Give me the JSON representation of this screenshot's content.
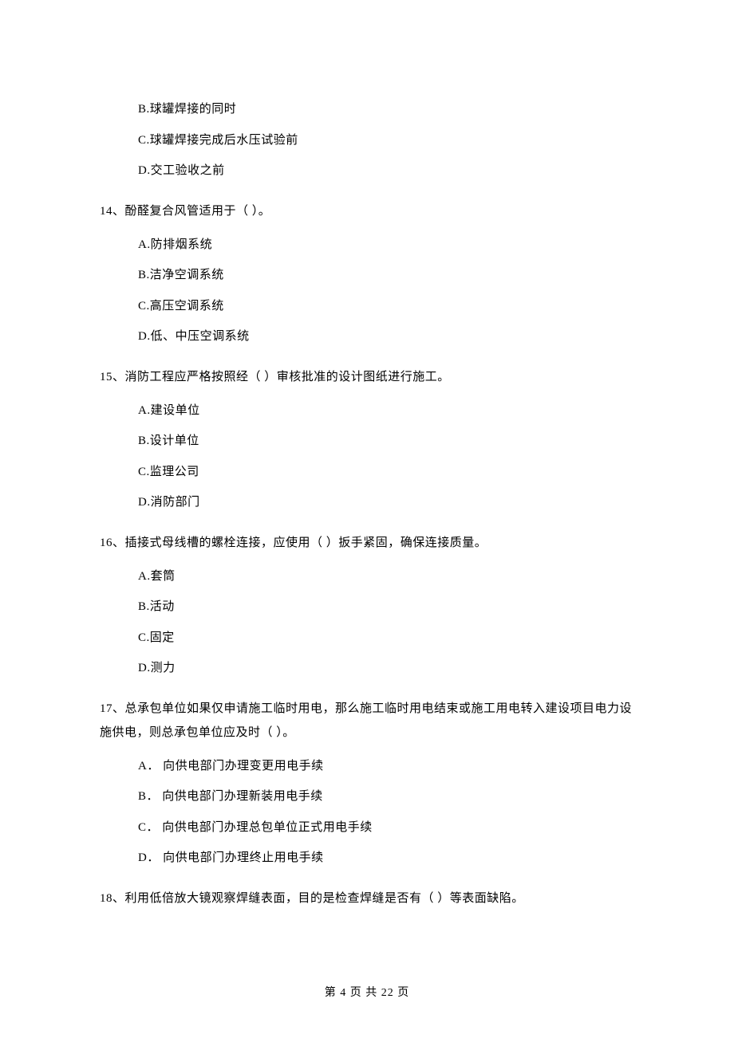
{
  "options_pre": {
    "b": "B.球罐焊接的同时",
    "c": "C.球罐焊接完成后水压试验前",
    "d": "D.交工验收之前"
  },
  "q14": {
    "stem": "14、酚醛复合风管适用于（    ）。",
    "a": "A.防排烟系统",
    "b": "B.洁净空调系统",
    "c": "C.高压空调系统",
    "d": "D.低、中压空调系统"
  },
  "q15": {
    "stem": "15、消防工程应严格按照经（    ）审核批准的设计图纸进行施工。",
    "a": "A.建设单位",
    "b": "B.设计单位",
    "c": "C.监理公司",
    "d": "D.消防部门"
  },
  "q16": {
    "stem": "16、插接式母线槽的螺栓连接，应使用（    ）扳手紧固，确保连接质量。",
    "a": "A.套筒",
    "b": "B.活动",
    "c": "C.固定",
    "d": "D.测力"
  },
  "q17": {
    "stem": "17、总承包单位如果仅申请施工临时用电，那么施工临时用电结束或施工用电转入建设项目电力设施供电，则总承包单位应及时（    ）。",
    "a": "A． 向供电部门办理变更用电手续",
    "b": "B． 向供电部门办理新装用电手续",
    "c": "C． 向供电部门办理总包单位正式用电手续",
    "d": "D． 向供电部门办理终止用电手续"
  },
  "q18": {
    "stem": "18、利用低倍放大镜观察焊缝表面，目的是检查焊缝是否有（     ）等表面缺陷。"
  },
  "footer": "第 4 页 共 22 页"
}
